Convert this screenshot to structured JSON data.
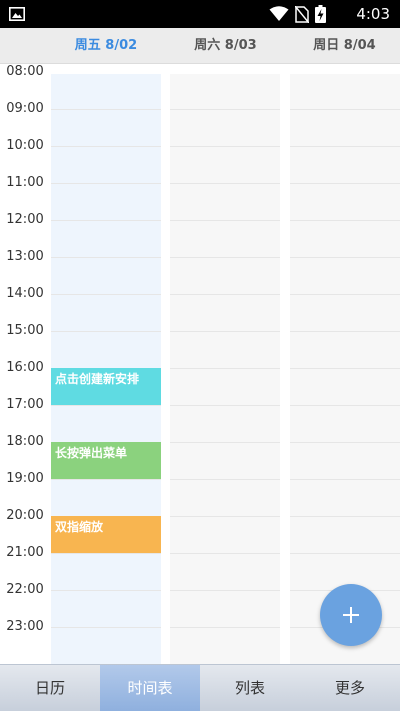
{
  "status_bar": {
    "time": "4:03"
  },
  "day_header": {
    "days": [
      {
        "label": "周五 8/02",
        "active": true
      },
      {
        "label": "周六 8/03",
        "active": false
      },
      {
        "label": "周日 8/04",
        "active": false
      }
    ]
  },
  "timeline": {
    "hours": [
      "08:00",
      "09:00",
      "10:00",
      "11:00",
      "12:00",
      "13:00",
      "14:00",
      "15:00",
      "16:00",
      "17:00",
      "18:00",
      "19:00",
      "20:00",
      "21:00",
      "22:00",
      "23:00"
    ]
  },
  "events": [
    {
      "title": "点击创建新安排",
      "start": "16:00",
      "end": "17:00",
      "color": "#5fdbe2"
    },
    {
      "title": "长按弹出菜单",
      "start": "18:00",
      "end": "19:00",
      "color": "#8bd27e"
    },
    {
      "title": "双指缩放",
      "start": "20:00",
      "end": "21:00",
      "color": "#f8b550"
    }
  ],
  "colors": {
    "accent": "#3b8be0",
    "fab": "#6aa2e0"
  },
  "fab": {
    "icon": "plus-icon"
  },
  "bottom_nav": {
    "items": [
      {
        "label": "日历",
        "active": false
      },
      {
        "label": "时间表",
        "active": true
      },
      {
        "label": "列表",
        "active": false
      },
      {
        "label": "更多",
        "active": false
      }
    ]
  }
}
